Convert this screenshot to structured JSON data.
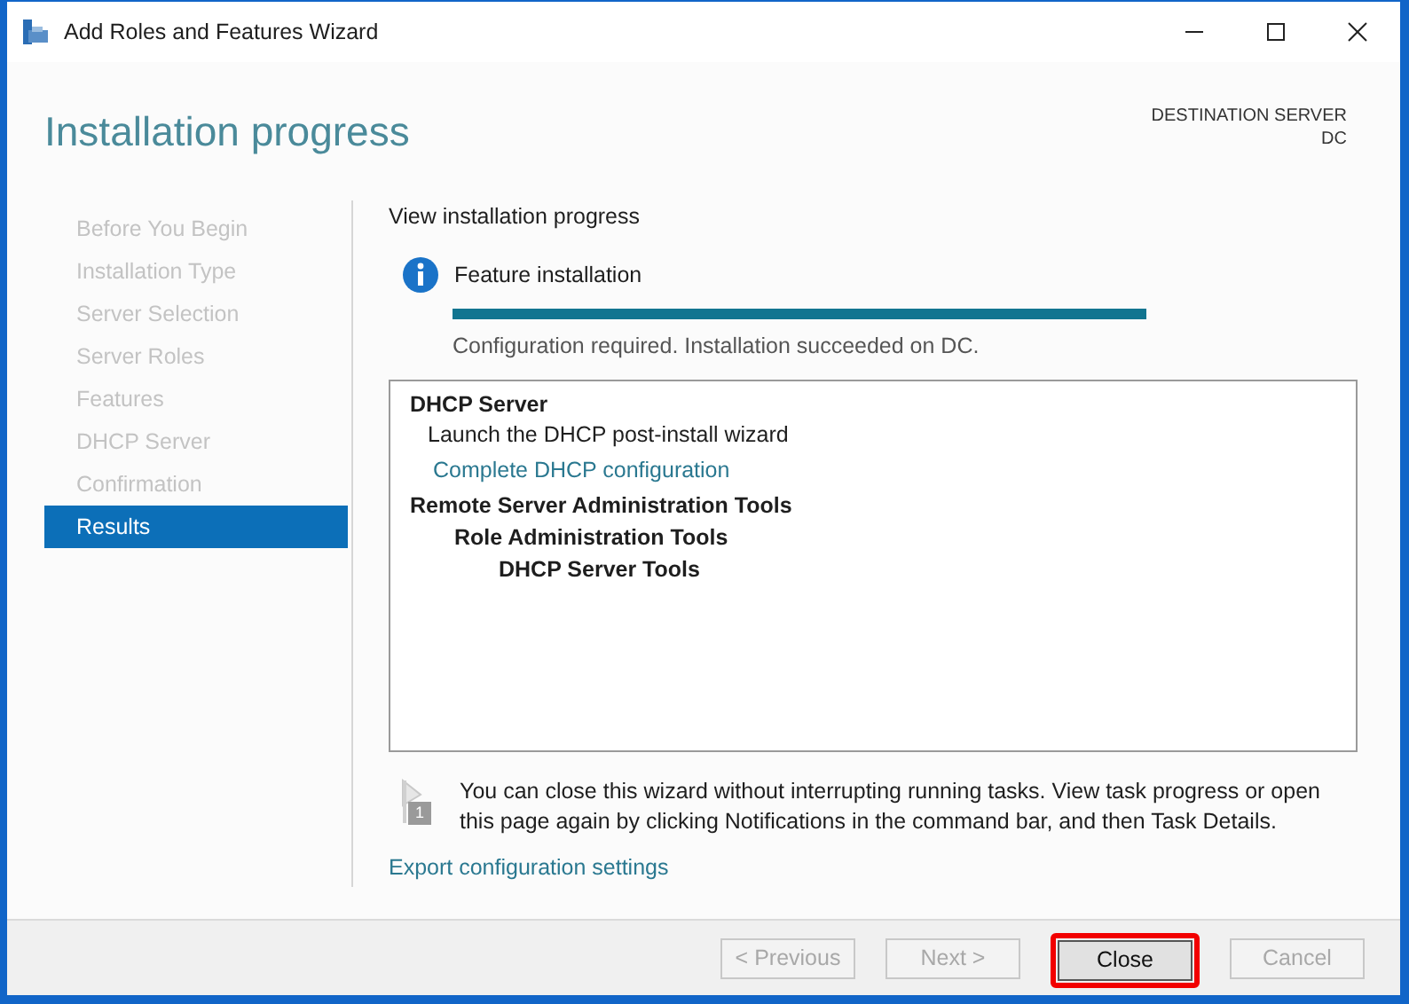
{
  "window": {
    "title": "Add Roles and Features Wizard"
  },
  "header": {
    "title": "Installation progress",
    "destination_label": "DESTINATION SERVER",
    "destination_server": "DC"
  },
  "sidebar": {
    "items": [
      {
        "label": "Before You Begin",
        "selected": false
      },
      {
        "label": "Installation Type",
        "selected": false
      },
      {
        "label": "Server Selection",
        "selected": false
      },
      {
        "label": "Server Roles",
        "selected": false
      },
      {
        "label": "Features",
        "selected": false
      },
      {
        "label": "DHCP Server",
        "selected": false
      },
      {
        "label": "Confirmation",
        "selected": false
      },
      {
        "label": "Results",
        "selected": true
      }
    ]
  },
  "content": {
    "heading": "View installation progress",
    "status_title": "Feature installation",
    "progress": {
      "level": 1
    },
    "status_message": "Configuration required. Installation succeeded on DC.",
    "results": [
      {
        "kind": "heading",
        "text": "DHCP Server",
        "children": [
          {
            "kind": "text",
            "text": "Launch the DHCP post-install wizard"
          },
          {
            "kind": "link",
            "text": "Complete DHCP configuration"
          }
        ]
      },
      {
        "kind": "heading",
        "text": "Remote Server Administration Tools",
        "children": [
          {
            "kind": "heading",
            "text": "Role Administration Tools",
            "children": [
              {
                "kind": "heading",
                "text": "DHCP Server Tools"
              }
            ]
          }
        ]
      }
    ],
    "notice": "You can close this wizard without interrupting running tasks. View task progress or open this page again by clicking Notifications in the command bar, and then Task Details.",
    "notification_badge": "1",
    "export_link": "Export configuration settings"
  },
  "buttons": [
    {
      "label": "< Previous",
      "disabled": true,
      "highlighted": false
    },
    {
      "label": "Next >",
      "disabled": true,
      "highlighted": false
    },
    {
      "label": "Close",
      "disabled": false,
      "highlighted": true
    },
    {
      "label": "Cancel",
      "disabled": true,
      "highlighted": false
    }
  ]
}
